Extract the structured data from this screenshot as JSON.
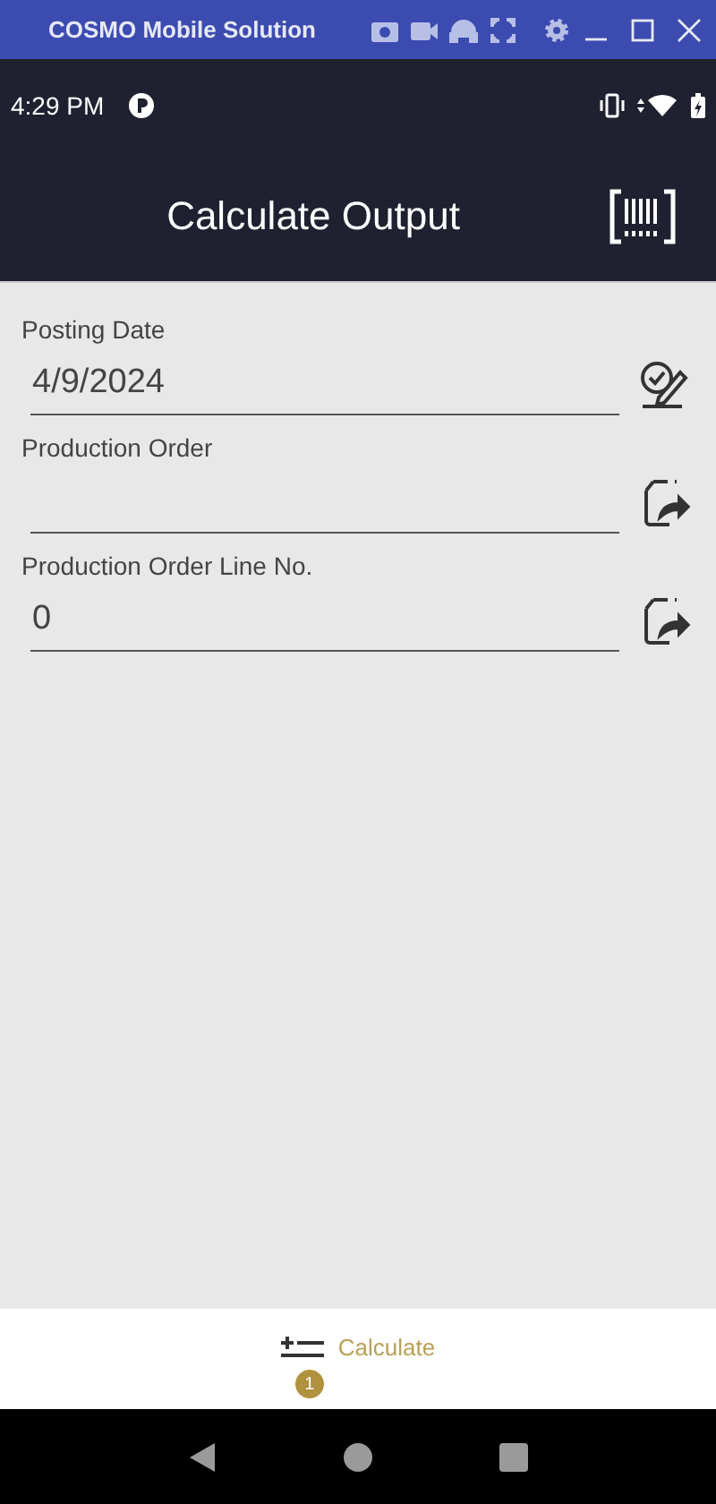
{
  "window": {
    "title": "COSMO Mobile Solution"
  },
  "status_bar": {
    "time": "4:29 PM"
  },
  "header": {
    "title": "Calculate Output"
  },
  "fields": [
    {
      "label": "Posting Date",
      "value": "4/9/2024",
      "kind": "date"
    },
    {
      "label": "Production Order",
      "kind": "lookup"
    },
    {
      "label": "Production Order Line No.",
      "value": "0",
      "kind": "lookup"
    }
  ],
  "bottom_action": {
    "label": "Calculate",
    "badge": "1"
  }
}
